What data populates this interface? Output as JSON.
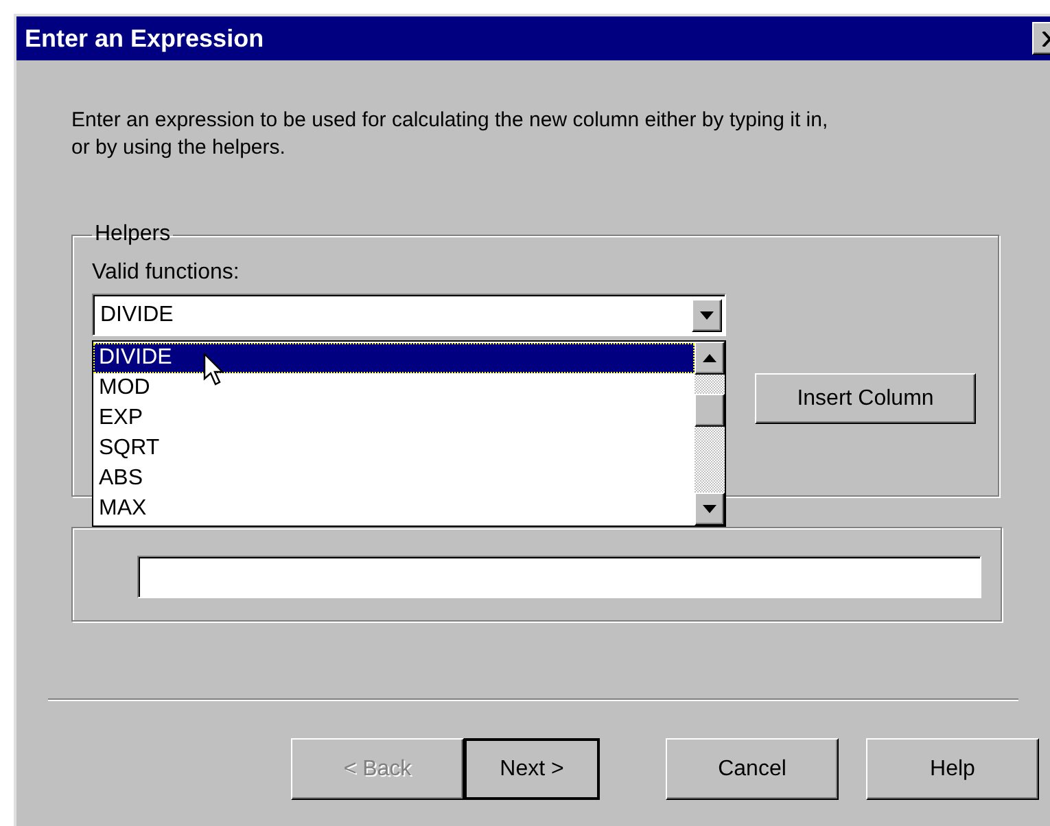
{
  "window": {
    "title": "Enter an Expression"
  },
  "intro": "Enter an expression to be used for calculating the new column either by typing it in, or by using the helpers.",
  "helpers": {
    "legend": "Helpers",
    "label": "Valid functions:",
    "combo_value": "DIVIDE",
    "expanded": true,
    "options": [
      {
        "label": "DIVIDE",
        "selected": true
      },
      {
        "label": "MOD",
        "selected": false
      },
      {
        "label": "EXP",
        "selected": false
      },
      {
        "label": "SQRT",
        "selected": false
      },
      {
        "label": "ABS",
        "selected": false
      },
      {
        "label": "MAX",
        "selected": false
      }
    ],
    "insert_button": "Insert Column"
  },
  "buttons": [
    {
      "label": "< Back",
      "disabled": true,
      "default": false
    },
    {
      "label": "Next >",
      "disabled": false,
      "default": true
    },
    {
      "label": "Cancel",
      "disabled": false,
      "default": false
    },
    {
      "label": "Help",
      "disabled": false,
      "default": false
    }
  ]
}
